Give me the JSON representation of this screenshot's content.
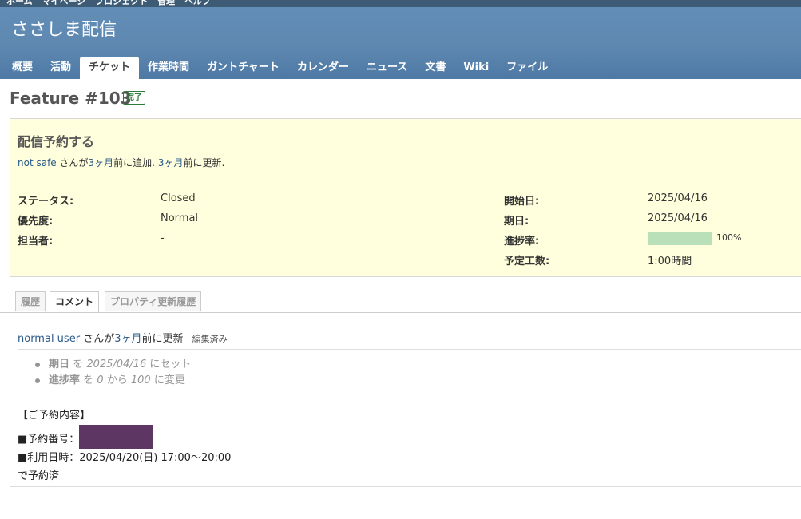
{
  "top_menu": [
    "ホーム",
    "マイページ",
    "プロジェクト",
    "管理",
    "ヘルプ"
  ],
  "project_title": "ささしま配信",
  "main_menu": [
    {
      "label": "概要",
      "selected": false
    },
    {
      "label": "活動",
      "selected": false
    },
    {
      "label": "チケット",
      "selected": true
    },
    {
      "label": "作業時間",
      "selected": false
    },
    {
      "label": "ガントチャート",
      "selected": false
    },
    {
      "label": "カレンダー",
      "selected": false
    },
    {
      "label": "ニュース",
      "selected": false
    },
    {
      "label": "文書",
      "selected": false
    },
    {
      "label": "Wiki",
      "selected": false
    },
    {
      "label": "ファイル",
      "selected": false
    }
  ],
  "issue": {
    "title": "Feature #103",
    "status_badge": "完了",
    "subject": "配信予約する",
    "author": "not safe",
    "added_text": "さんが",
    "added_ago": "3ヶ月",
    "added_suffix": "前に追加.",
    "updated_ago": "3ヶ月",
    "updated_suffix": "前に更新.",
    "attributes_left": [
      {
        "label": "ステータス:",
        "value": "Closed"
      },
      {
        "label": "優先度:",
        "value": "Normal"
      },
      {
        "label": "担当者:",
        "value": "-"
      }
    ],
    "attributes_right": [
      {
        "label": "開始日:",
        "value": "2025/04/16"
      },
      {
        "label": "期日:",
        "value": "2025/04/16"
      },
      {
        "label": "進捗率:",
        "value": "100%"
      },
      {
        "label": "予定工数:",
        "value": "1:00時間"
      }
    ],
    "progress_percent": 100
  },
  "history_tabs": [
    {
      "label": "履歴",
      "selected": false
    },
    {
      "label": "コメント",
      "selected": true
    },
    {
      "label": "プロパティ更新履歴",
      "selected": false
    }
  ],
  "journal": {
    "user": "normal user",
    "user_suffix": "さんが",
    "ago": "3ヶ月",
    "ago_suffix": "前に更新",
    "edited": "· 編集済み",
    "details": [
      {
        "field": "期日",
        "p1": "を",
        "v1": "2025/04/16",
        "p2": "にセット",
        "v2": "",
        "p3": ""
      },
      {
        "field": "進捗率",
        "p1": "を",
        "v1": "0",
        "p2": "から",
        "v2": "100",
        "p3": "に変更"
      }
    ],
    "notes": {
      "line1": "【ご予約内容】",
      "line2_prefix": "■予約番号：",
      "line3": "■利用日時：2025/04/20(日) 17:00〜20:00",
      "line4": "で予約済"
    }
  },
  "colors": {
    "header": "#628db6",
    "issue_box": "#ffffdd",
    "progress_fill": "#bae0ba",
    "badge": "#2d7a3a",
    "redaction": "#5e3663"
  }
}
